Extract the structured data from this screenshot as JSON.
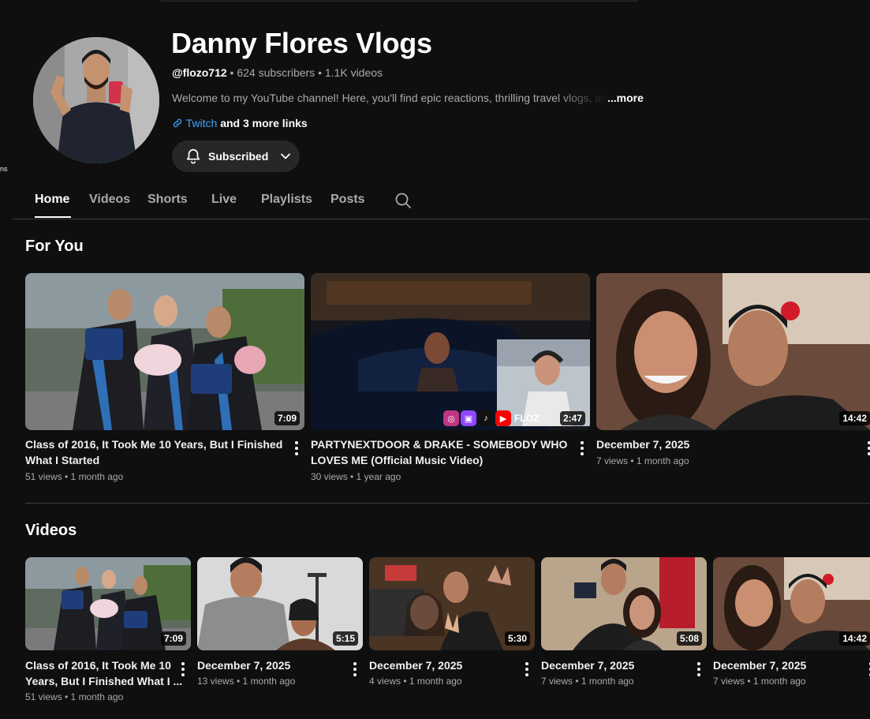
{
  "left_fragment": "ns",
  "channel": {
    "name": "Danny Flores Vlogs",
    "handle": "@flozo712",
    "separator": " • ",
    "subscribers": "624 subscribers",
    "videos_count": "1.1K videos",
    "description": "Welcome to my YouTube channel! Here, you'll find epic reactions, thrilling travel vlogs, and",
    "more_label": "...more",
    "link_label": "Twitch",
    "more_links": " and 3 more links",
    "subscribe_label": "Subscribed"
  },
  "tabs": [
    {
      "label": "Home",
      "active": true
    },
    {
      "label": "Videos"
    },
    {
      "label": "Shorts"
    },
    {
      "label": "Live"
    },
    {
      "label": "Playlists"
    },
    {
      "label": "Posts"
    }
  ],
  "sections": {
    "for_you": "For You",
    "videos": "Videos"
  },
  "for_you": [
    {
      "title_line1": "Class of 2016, It Took Me 10 Years, But I Finished",
      "title_line2": "What I Started",
      "meta": "51 views • 1 month ago",
      "duration": "7:09"
    },
    {
      "title_line1": "PARTYNEXTDOOR & DRAKE - SOMEBODY WHO",
      "title_line2": "LOVES ME (Official Music Video)",
      "meta": "30 views • 1 year ago",
      "duration": "2:47",
      "overlay_text": "FLOZ"
    },
    {
      "title_line1": "December 7, 2025",
      "title_line2": "",
      "meta": "7 views • 1 month ago",
      "duration": "14:42"
    }
  ],
  "videos": [
    {
      "title_line1": "Class of 2016, It Took Me 10",
      "title_line2": "Years, But I Finished What I ...",
      "meta": "51 views • 1 month ago",
      "duration": "7:09"
    },
    {
      "title_line1": "December 7, 2025",
      "title_line2": "",
      "meta": "13 views • 1 month ago",
      "duration": "5:15"
    },
    {
      "title_line1": "December 7, 2025",
      "title_line2": "",
      "meta": "4 views • 1 month ago",
      "duration": "5:30"
    },
    {
      "title_line1": "December 7, 2025",
      "title_line2": "",
      "meta": "7 views • 1 month ago",
      "duration": "5:08"
    },
    {
      "title_line1": "December 7, 2025",
      "title_line2": "",
      "meta": "7 views • 1 month ago",
      "duration": "14:42"
    }
  ]
}
